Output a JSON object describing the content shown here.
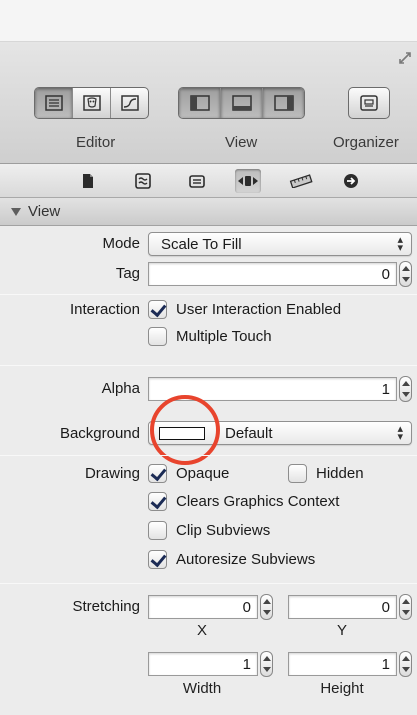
{
  "toolbar": {
    "editor_label": "Editor",
    "view_label": "View",
    "organizer_label": "Organizer"
  },
  "inspector_tabs": [
    "file-inspector-icon",
    "quick-help-icon",
    "identity-inspector-icon",
    "attributes-inspector-icon",
    "size-inspector-icon",
    "connections-inspector-icon"
  ],
  "section": {
    "title": "View"
  },
  "fields": {
    "mode_label": "Mode",
    "mode_value": "Scale To Fill",
    "tag_label": "Tag",
    "tag_value": "0",
    "interaction_label": "Interaction",
    "user_interaction_label": "User Interaction Enabled",
    "multiple_touch_label": "Multiple Touch",
    "alpha_label": "Alpha",
    "alpha_value": "1",
    "background_label": "Background",
    "background_value": "Default",
    "drawing_label": "Drawing",
    "opaque_label": "Opaque",
    "hidden_label": "Hidden",
    "clears_label": "Clears Graphics Context",
    "clip_label": "Clip Subviews",
    "autoresize_label": "Autoresize Subviews",
    "stretching_label": "Stretching",
    "stretch_x_value": "0",
    "stretch_y_value": "0",
    "x_caption": "X",
    "y_caption": "Y",
    "stretch_width_value": "1",
    "stretch_height_value": "1",
    "width_caption": "Width",
    "height_caption": "Height"
  },
  "states": {
    "user_interaction_enabled": true,
    "multiple_touch": false,
    "opaque": true,
    "hidden": false,
    "clears_graphics_context": true,
    "clip_subviews": false,
    "autoresize_subviews": true
  },
  "colors": {
    "highlight_ring": "#e8442d",
    "check_mark": "#1b2b55"
  }
}
